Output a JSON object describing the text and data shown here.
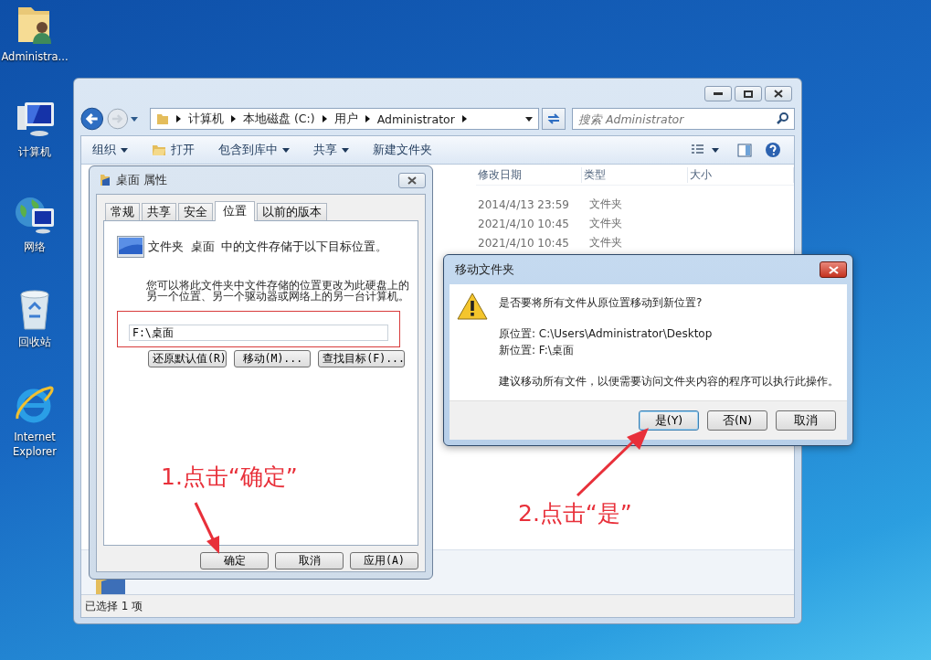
{
  "desktop_icons": [
    {
      "kind": "user-folder",
      "label": "Administra..."
    },
    {
      "kind": "computer",
      "label": "计算机"
    },
    {
      "kind": "network",
      "label": "网络"
    },
    {
      "kind": "recycle-bin",
      "label": "回收站"
    },
    {
      "kind": "browser",
      "label": "Internet Explorer"
    }
  ],
  "explorer": {
    "breadcrumb": [
      "计算机",
      "本地磁盘 (C:)",
      "用户",
      "Administrator"
    ],
    "search": {
      "placeholder": "搜索 Administrator"
    },
    "toolbar": [
      {
        "kind": "menu",
        "label": "组织",
        "dropdown": true
      },
      {
        "kind": "open",
        "label": "打开",
        "dropdown": false
      },
      {
        "kind": "menu",
        "label": "包含到库中",
        "dropdown": true
      },
      {
        "kind": "menu",
        "label": "共享",
        "dropdown": true
      },
      {
        "kind": "command",
        "label": "新建文件夹",
        "dropdown": false
      }
    ],
    "columns": [
      "修改日期",
      "类型",
      "大小"
    ],
    "rows": [
      {
        "date": "2014/4/13 23:59",
        "type": "文件夹"
      },
      {
        "date": "2021/4/10 10:45",
        "type": "文件夹"
      },
      {
        "date": "2021/4/10 10:45",
        "type": "文件夹"
      }
    ],
    "status": "已选择 1 项"
  },
  "properties": {
    "title": "桌面 属性",
    "tabs": [
      {
        "label": "常规",
        "selected": false
      },
      {
        "label": "共享",
        "selected": false
      },
      {
        "label": "安全",
        "selected": false
      },
      {
        "label": "位置",
        "selected": true
      },
      {
        "label": "以前的版本",
        "selected": false
      }
    ],
    "description": "文件夹 桌面 中的文件存储于以下目标位置。",
    "hint": "您可以将此文件夹中文件存储的位置更改为此硬盘上的另一个位置、另一个驱动器或网络上的另一台计算机。",
    "path": "F:\\桌面",
    "path_buttons": [
      "还原默认值(R)",
      "移动(M)...",
      "查找目标(F)..."
    ],
    "buttons": [
      "确定",
      "取消",
      "应用(A)"
    ]
  },
  "move_dialog": {
    "title": "移动文件夹",
    "question": "是否要将所有文件从原位置移动到新位置?",
    "source": "原位置: C:\\Users\\Administrator\\Desktop",
    "target": "新位置: F:\\桌面",
    "advice": "建议移动所有文件，以便需要访问文件夹内容的程序可以执行此操作。",
    "buttons": [
      {
        "label": "是(Y)",
        "default": true
      },
      {
        "label": "否(N)",
        "default": false
      },
      {
        "label": "取消",
        "default": false
      }
    ]
  },
  "annotations": [
    {
      "text": "1.点击“确定”"
    },
    {
      "text": "2.点击“是”"
    }
  ]
}
